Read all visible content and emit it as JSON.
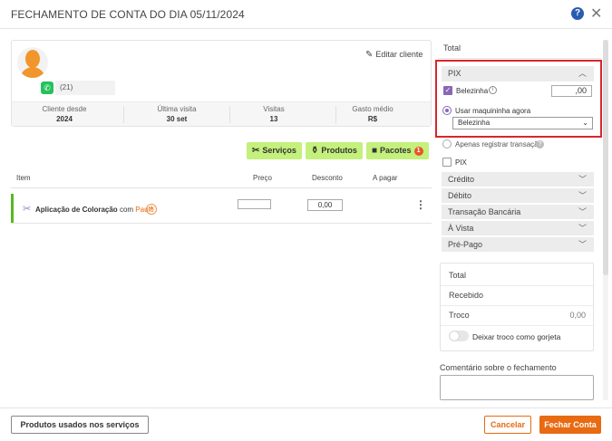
{
  "dialog": {
    "title": "FECHAMENTO DE CONTA DO DIA 05/11/2024"
  },
  "client": {
    "phone": "(21)",
    "edit_label": "Editar cliente",
    "stats": [
      {
        "label": "Cliente desde",
        "value": "2024"
      },
      {
        "label": "Última visita",
        "value": "30 set"
      },
      {
        "label": "Visitas",
        "value": "13"
      },
      {
        "label": "Gasto médio",
        "value": "R$"
      }
    ]
  },
  "item_buttons": {
    "services": "Serviços",
    "products": "Produtos",
    "packages": "Pacotes",
    "packages_count": "1"
  },
  "table": {
    "headers": {
      "item": "Item",
      "price": "Preço",
      "discount": "Desconto",
      "to_pay": "A pagar"
    },
    "rows": [
      {
        "service": "Aplicação de Coloração",
        "with_word": "com",
        "professional": "Paulo",
        "price": "",
        "discount": "0,00",
        "to_pay": ""
      }
    ]
  },
  "footer": {
    "products_used": "Produtos usados nos serviços",
    "cancel": "Cancelar",
    "confirm": "Fechar Conta"
  },
  "payment": {
    "total_label": "Total",
    "pix": {
      "title": "PIX",
      "account_label": "Belezinha",
      "account_checked": true,
      "amount": ",00",
      "use_terminal_label": "Usar maquininha agora",
      "terminal_selected": "Belezinha",
      "register_only_label": "Apenas registrar transação",
      "pix_check_label": "PIX"
    },
    "methods": [
      "Crédito",
      "Débito",
      "Transação Bancária",
      "À Vista",
      "Pré-Pago"
    ],
    "summary": {
      "total_label": "Total",
      "received_label": "Recebido",
      "change_label": "Troco",
      "change_value": "0,00",
      "tip_toggle_label": "Deixar troco como gorjeta"
    },
    "comment_label": "Comentário sobre o fechamento"
  },
  "colors": {
    "accent_orange": "#e86a12",
    "green_button": "#c4f07c",
    "purple": "#8a67b5",
    "highlight_red": "#d9262c"
  }
}
